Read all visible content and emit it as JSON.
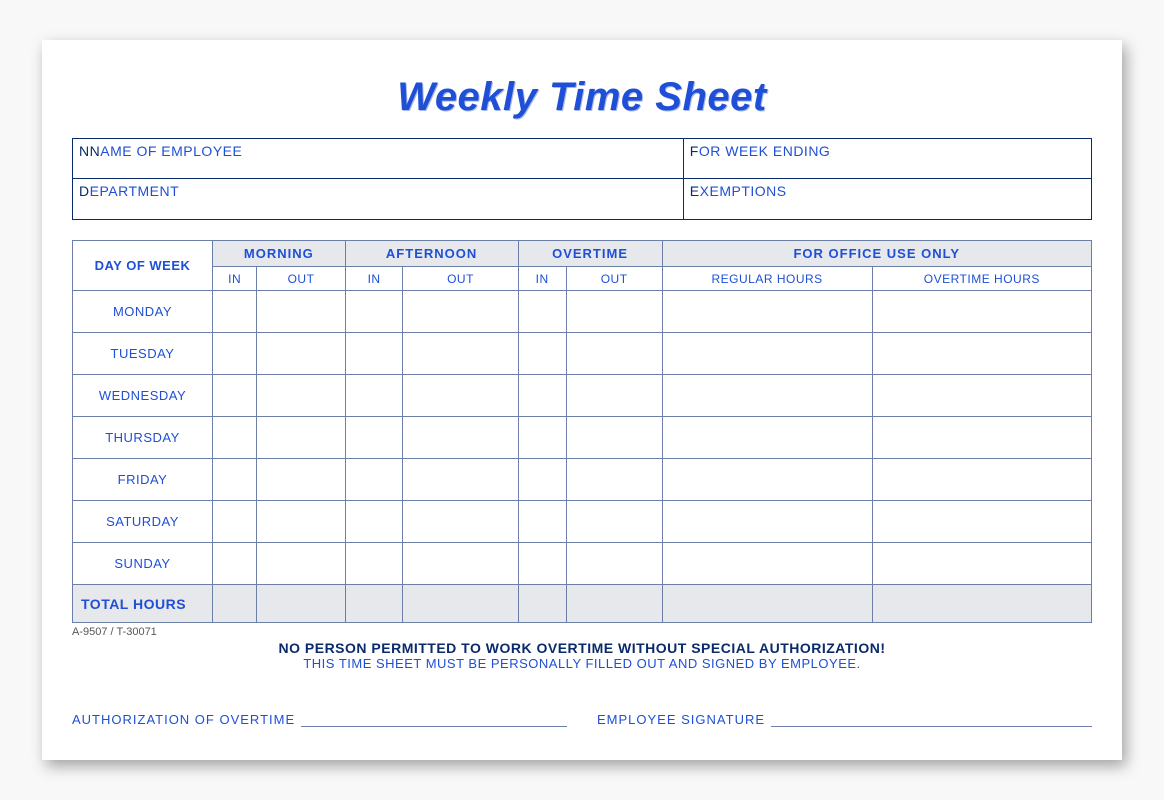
{
  "title": "Weekly Time Sheet",
  "info": {
    "name_label": "NAME OF EMPLOYEE",
    "week_label": "FOR WEEK ENDING",
    "dept_label": "DEPARTMENT",
    "exempt_label": "EXEMPTIONS"
  },
  "headers": {
    "dow": "DAY OF WEEK",
    "morning": "MORNING",
    "afternoon": "AFTERNOON",
    "overtime": "OVERTIME",
    "office": "FOR OFFICE USE ONLY",
    "in": "IN",
    "out": "OUT",
    "regular": "REGULAR HOURS",
    "otcol": "OVERTIME HOURS"
  },
  "days": [
    "MONDAY",
    "TUESDAY",
    "WEDNESDAY",
    "THURSDAY",
    "FRIDAY",
    "SATURDAY",
    "SUNDAY"
  ],
  "total_label": "TOTAL HOURS",
  "form_code": "A-9507 / T-30071",
  "notice_line1": "NO PERSON PERMITTED TO WORK OVERTIME WITHOUT SPECIAL AUTHORIZATION!",
  "notice_line2": "THIS TIME SHEET MUST BE PERSONALLY FILLED OUT AND SIGNED BY EMPLOYEE.",
  "sig": {
    "auth": "AUTHORIZATION OF OVERTIME",
    "emp": "EMPLOYEE SIGNATURE"
  }
}
